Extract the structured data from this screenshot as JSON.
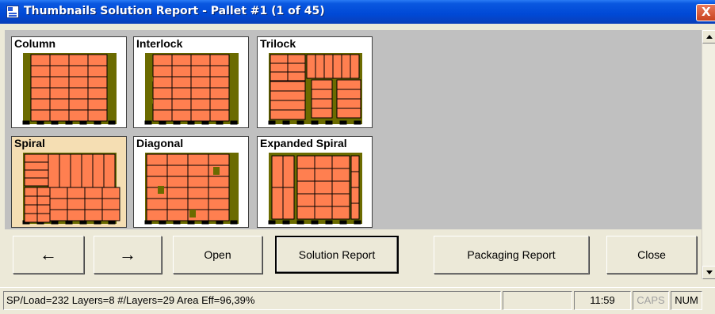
{
  "window": {
    "title": "Thumbnails Solution Report - Pallet #1 (1 of 45)",
    "close_glyph": "X"
  },
  "thumbnails": [
    {
      "label": "Column",
      "pattern": "column",
      "selected": false
    },
    {
      "label": "Interlock",
      "pattern": "interlock",
      "selected": false
    },
    {
      "label": "Trilock",
      "pattern": "trilock",
      "selected": false
    },
    {
      "label": "Spiral",
      "pattern": "spiral",
      "selected": true
    },
    {
      "label": "Diagonal",
      "pattern": "diagonal",
      "selected": false
    },
    {
      "label": "Expanded Spiral",
      "pattern": "expanded-spiral",
      "selected": false
    }
  ],
  "buttons": {
    "prev": "←",
    "next": "→",
    "open": "Open",
    "solution_report": "Solution Report",
    "packaging_report": "Packaging Report",
    "close": "Close"
  },
  "status": {
    "info": "SP/Load=232 Layers=8 #/Layers=29 Area Eff=96,39%",
    "empty": "",
    "time": "11:59",
    "caps": "CAPS",
    "num": "NUM"
  },
  "colors": {
    "box": "#FF7F50",
    "pallet": "#6B6B00",
    "selected_bg": "#F5DEB3"
  }
}
